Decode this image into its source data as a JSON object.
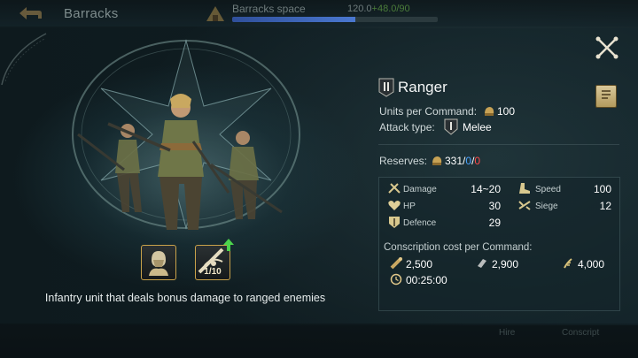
{
  "top_bar": {
    "title": "Barracks",
    "space_label": "Barracks space",
    "space_value_white": "120.0",
    "space_value_green": "+48.0/90",
    "space_fill_fraction": 0.6
  },
  "unit": {
    "name": "Ranger",
    "units_per_command_label": "Units per Command:",
    "units_per_command_value": "100",
    "attack_type_label": "Attack type:",
    "attack_type_value": "Melee",
    "reserves_label": "Reserves:",
    "reserves_value": "331",
    "reserves_sep1": "/",
    "reserves_blue": "0",
    "reserves_sep2": "/",
    "reserves_red": "0",
    "skill_level": "1/10",
    "description": "Infantry unit that deals bonus damage to ranged enemies"
  },
  "stats": {
    "damage_label": "Damage",
    "damage_value": "14~20",
    "hp_label": "HP",
    "hp_value": "30",
    "defence_label": "Defence",
    "defence_value": "29",
    "speed_label": "Speed",
    "speed_value": "100",
    "siege_label": "Siege",
    "siege_value": "12"
  },
  "cost": {
    "title": "Conscription cost per Command:",
    "wood": "2,500",
    "iron": "2,900",
    "food": "4,000",
    "time": "00:25:00"
  },
  "bottom_bar": {
    "left_hint": "Hire",
    "right_hint": "Conscript"
  },
  "colors": {
    "accent_gold": "#c9a24a",
    "reserve_blue": "#4aa3ff",
    "reserve_red": "#ff4b4b"
  },
  "icons": [
    "back-arrow-icon",
    "barracks-icon",
    "close-icon",
    "info-scroll-icon",
    "infantry-badge-icon",
    "helmet-icon",
    "melee-shield-icon",
    "damage-icon",
    "hp-heart-icon",
    "defence-shield-icon",
    "speed-boot-icon",
    "siege-icon",
    "wood-icon",
    "iron-icon",
    "food-icon",
    "clock-icon"
  ]
}
